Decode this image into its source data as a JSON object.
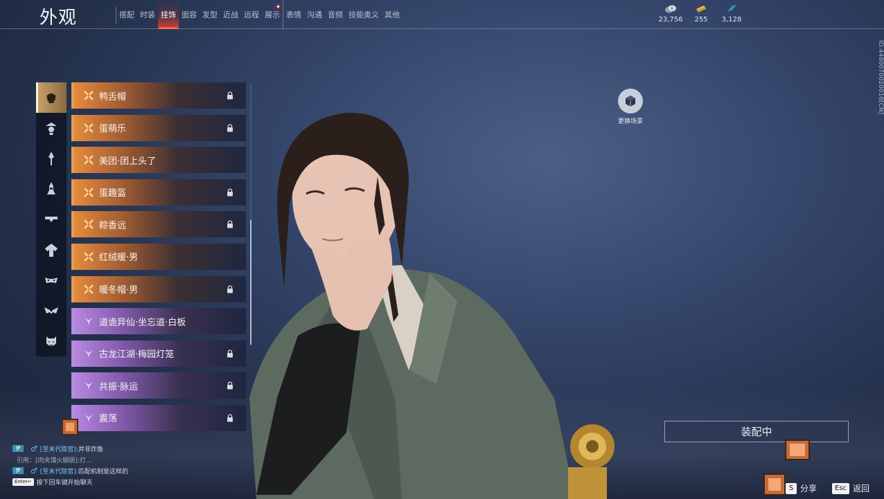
{
  "header": {
    "title": "外观",
    "tabs": [
      {
        "label": "搭配",
        "active": false
      },
      {
        "label": "时装",
        "active": false
      },
      {
        "label": "挂饰",
        "active": true
      },
      {
        "label": "面容",
        "active": false
      },
      {
        "label": "发型",
        "active": false
      },
      {
        "label": "近战",
        "active": false
      },
      {
        "label": "远程",
        "active": false
      },
      {
        "label": "展示",
        "active": false,
        "alert": true
      },
      {
        "label": "表情",
        "active": false
      },
      {
        "label": "沟通",
        "active": false
      },
      {
        "label": "音频",
        "active": false
      },
      {
        "label": "技能奥义",
        "active": false
      },
      {
        "label": "其他",
        "active": false
      }
    ],
    "currencies": [
      {
        "icon": "silver-coin-icon",
        "value": "23,756"
      },
      {
        "icon": "ticket-icon",
        "value": "255"
      },
      {
        "icon": "feather-icon",
        "value": "3,128"
      }
    ],
    "side_id": "ID:4480070020016[CN]"
  },
  "categories": [
    {
      "icon": "headwear-icon",
      "active": true
    },
    {
      "icon": "hat-icon",
      "active": false
    },
    {
      "icon": "hairpin-icon",
      "active": false
    },
    {
      "icon": "back-ornament-icon",
      "active": false
    },
    {
      "icon": "waist-icon",
      "active": false
    },
    {
      "icon": "cape-icon",
      "active": false
    },
    {
      "icon": "face-mask-icon",
      "active": false
    },
    {
      "icon": "eye-mask-icon",
      "active": false
    },
    {
      "icon": "demon-mask-icon",
      "active": false
    }
  ],
  "items": [
    {
      "label": "鸭舌帽",
      "rarity": "orange",
      "locked": true
    },
    {
      "label": "蛋萌乐",
      "rarity": "orange",
      "locked": true
    },
    {
      "label": "美团·团上头了",
      "rarity": "orange",
      "locked": false
    },
    {
      "label": "蛋趣盔",
      "rarity": "orange",
      "locked": true
    },
    {
      "label": "粽香远",
      "rarity": "orange",
      "locked": true
    },
    {
      "label": "红绒暖·男",
      "rarity": "orange",
      "locked": false
    },
    {
      "label": "暖冬帽·男",
      "rarity": "orange",
      "locked": true
    },
    {
      "label": "道诡异仙·坐忘道·白板",
      "rarity": "purple",
      "locked": false
    },
    {
      "label": "古龙江湖·梅园灯笼",
      "rarity": "purple",
      "locked": true
    },
    {
      "label": "共振·脉运",
      "rarity": "purple",
      "locked": true
    },
    {
      "label": "震荡",
      "rarity": "purple",
      "locked": true
    }
  ],
  "scene": {
    "label": "更换场景"
  },
  "equipped_label": "装配中",
  "chat": {
    "lines": [
      {
        "tag": "梦",
        "name": "[至末代隐官]:",
        "text": "并非炸鱼"
      },
      {
        "quote": "引用：[肉夹馍火腿肠]:打..."
      },
      {
        "tag": "梦",
        "name": "[至末代隐官]:",
        "text": "匹配机制是这样的"
      }
    ],
    "enter_key": "Enter↵",
    "enter_hint": "按下回车键开始聊天"
  },
  "hints": {
    "share_key": "S",
    "share_label": "分享",
    "back_key": "Esc",
    "back_label": "返回"
  },
  "colors": {
    "accent_red": "#ff5a3a",
    "orange_rarity": "#e58a3d",
    "purple_rarity": "#b687e0"
  }
}
